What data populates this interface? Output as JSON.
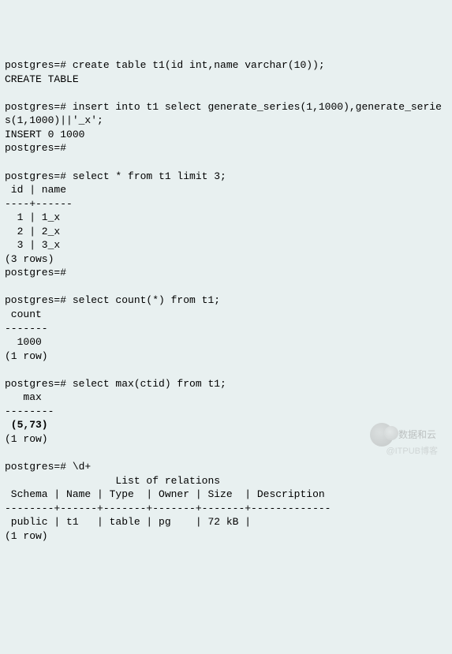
{
  "lines": [
    {
      "text": "postgres=# create table t1(id int,name varchar(10));",
      "bold": false
    },
    {
      "text": "CREATE TABLE",
      "bold": false
    },
    {
      "text": "",
      "bold": false
    },
    {
      "text": "postgres=# insert into t1 select generate_series(1,1000),generate_serie",
      "bold": false
    },
    {
      "text": "s(1,1000)||'_x';",
      "bold": false
    },
    {
      "text": "INSERT 0 1000",
      "bold": false
    },
    {
      "text": "postgres=#",
      "bold": false
    },
    {
      "text": "",
      "bold": false
    },
    {
      "text": "postgres=# select * from t1 limit 3;",
      "bold": false
    },
    {
      "text": " id | name",
      "bold": false
    },
    {
      "text": "----+------",
      "bold": false
    },
    {
      "text": "  1 | 1_x",
      "bold": false
    },
    {
      "text": "  2 | 2_x",
      "bold": false
    },
    {
      "text": "  3 | 3_x",
      "bold": false
    },
    {
      "text": "(3 rows)",
      "bold": false
    },
    {
      "text": "postgres=#",
      "bold": false
    },
    {
      "text": "",
      "bold": false
    },
    {
      "text": "postgres=# select count(*) from t1;",
      "bold": false
    },
    {
      "text": " count",
      "bold": false
    },
    {
      "text": "-------",
      "bold": false
    },
    {
      "text": "  1000",
      "bold": false
    },
    {
      "text": "(1 row)",
      "bold": false
    },
    {
      "text": "",
      "bold": false
    },
    {
      "text": "postgres=# select max(ctid) from t1;",
      "bold": false
    },
    {
      "text": "   max",
      "bold": false
    },
    {
      "text": "--------",
      "bold": false
    },
    {
      "text": " (5,73)",
      "bold": true
    },
    {
      "text": "(1 row)",
      "bold": false
    },
    {
      "text": "",
      "bold": false
    },
    {
      "text": "postgres=# \\d+",
      "bold": false
    },
    {
      "text": "                  List of relations",
      "bold": false
    },
    {
      "text": " Schema | Name | Type  | Owner | Size  | Description",
      "bold": false
    },
    {
      "text": "--------+------+-------+-------+-------+-------------",
      "bold": false
    },
    {
      "text": " public | t1   | table | pg    | 72 kB |",
      "bold": false
    },
    {
      "text": "(1 row)",
      "bold": false
    }
  ],
  "watermark1": "数据和云",
  "watermark2": "@ITPUB博客"
}
